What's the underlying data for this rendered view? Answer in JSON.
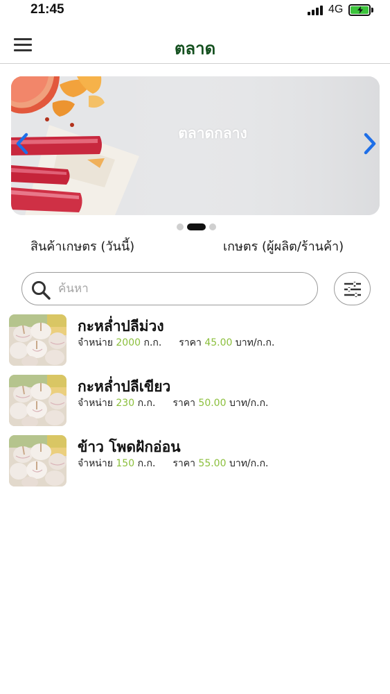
{
  "status": {
    "time": "21:45",
    "network": "4G"
  },
  "header": {
    "title": "ตลาด"
  },
  "banner": {
    "caption": "ตลาดกลาง"
  },
  "tabs": [
    {
      "label": "สินค้าเกษตร (วันนี้)"
    },
    {
      "label": "เกษตร (ผู้ผลิต/ร้านค้า)"
    }
  ],
  "search": {
    "placeholder": "ค้นหา",
    "value": ""
  },
  "products": [
    {
      "name": "กะหล่ำปลีม่วง",
      "sell_label": "จำหน่าย",
      "quantity": "2000",
      "unit": "ก.ก.",
      "price_label": "ราคา",
      "price": "45.00",
      "price_unit": "บาท/ก.ก."
    },
    {
      "name": "กะหล่ำปลีเขียว",
      "sell_label": "จำหน่าย",
      "quantity": "230",
      "unit": "ก.ก.",
      "price_label": "ราคา",
      "price": "50.00",
      "price_unit": "บาท/ก.ก."
    },
    {
      "name": "ข้าว โพดฝักอ่อน",
      "sell_label": "จำหน่าย",
      "quantity": "150",
      "unit": "ก.ก.",
      "price_label": "ราคา",
      "price": "55.00",
      "price_unit": "บาท/ก.ก."
    }
  ],
  "icons": {
    "menu": "hamburger-menu-icon",
    "search": "search-icon",
    "filter": "sliders-filter-icon",
    "prev": "chevron-left-icon",
    "next": "chevron-right-icon"
  },
  "colors": {
    "title": "#14501f",
    "accent_numbers": "#8bbf3c",
    "arrow": "#1e6fe8",
    "battery": "#3cc33c"
  },
  "carousel": {
    "slide_count": 3,
    "active_index": 1
  }
}
